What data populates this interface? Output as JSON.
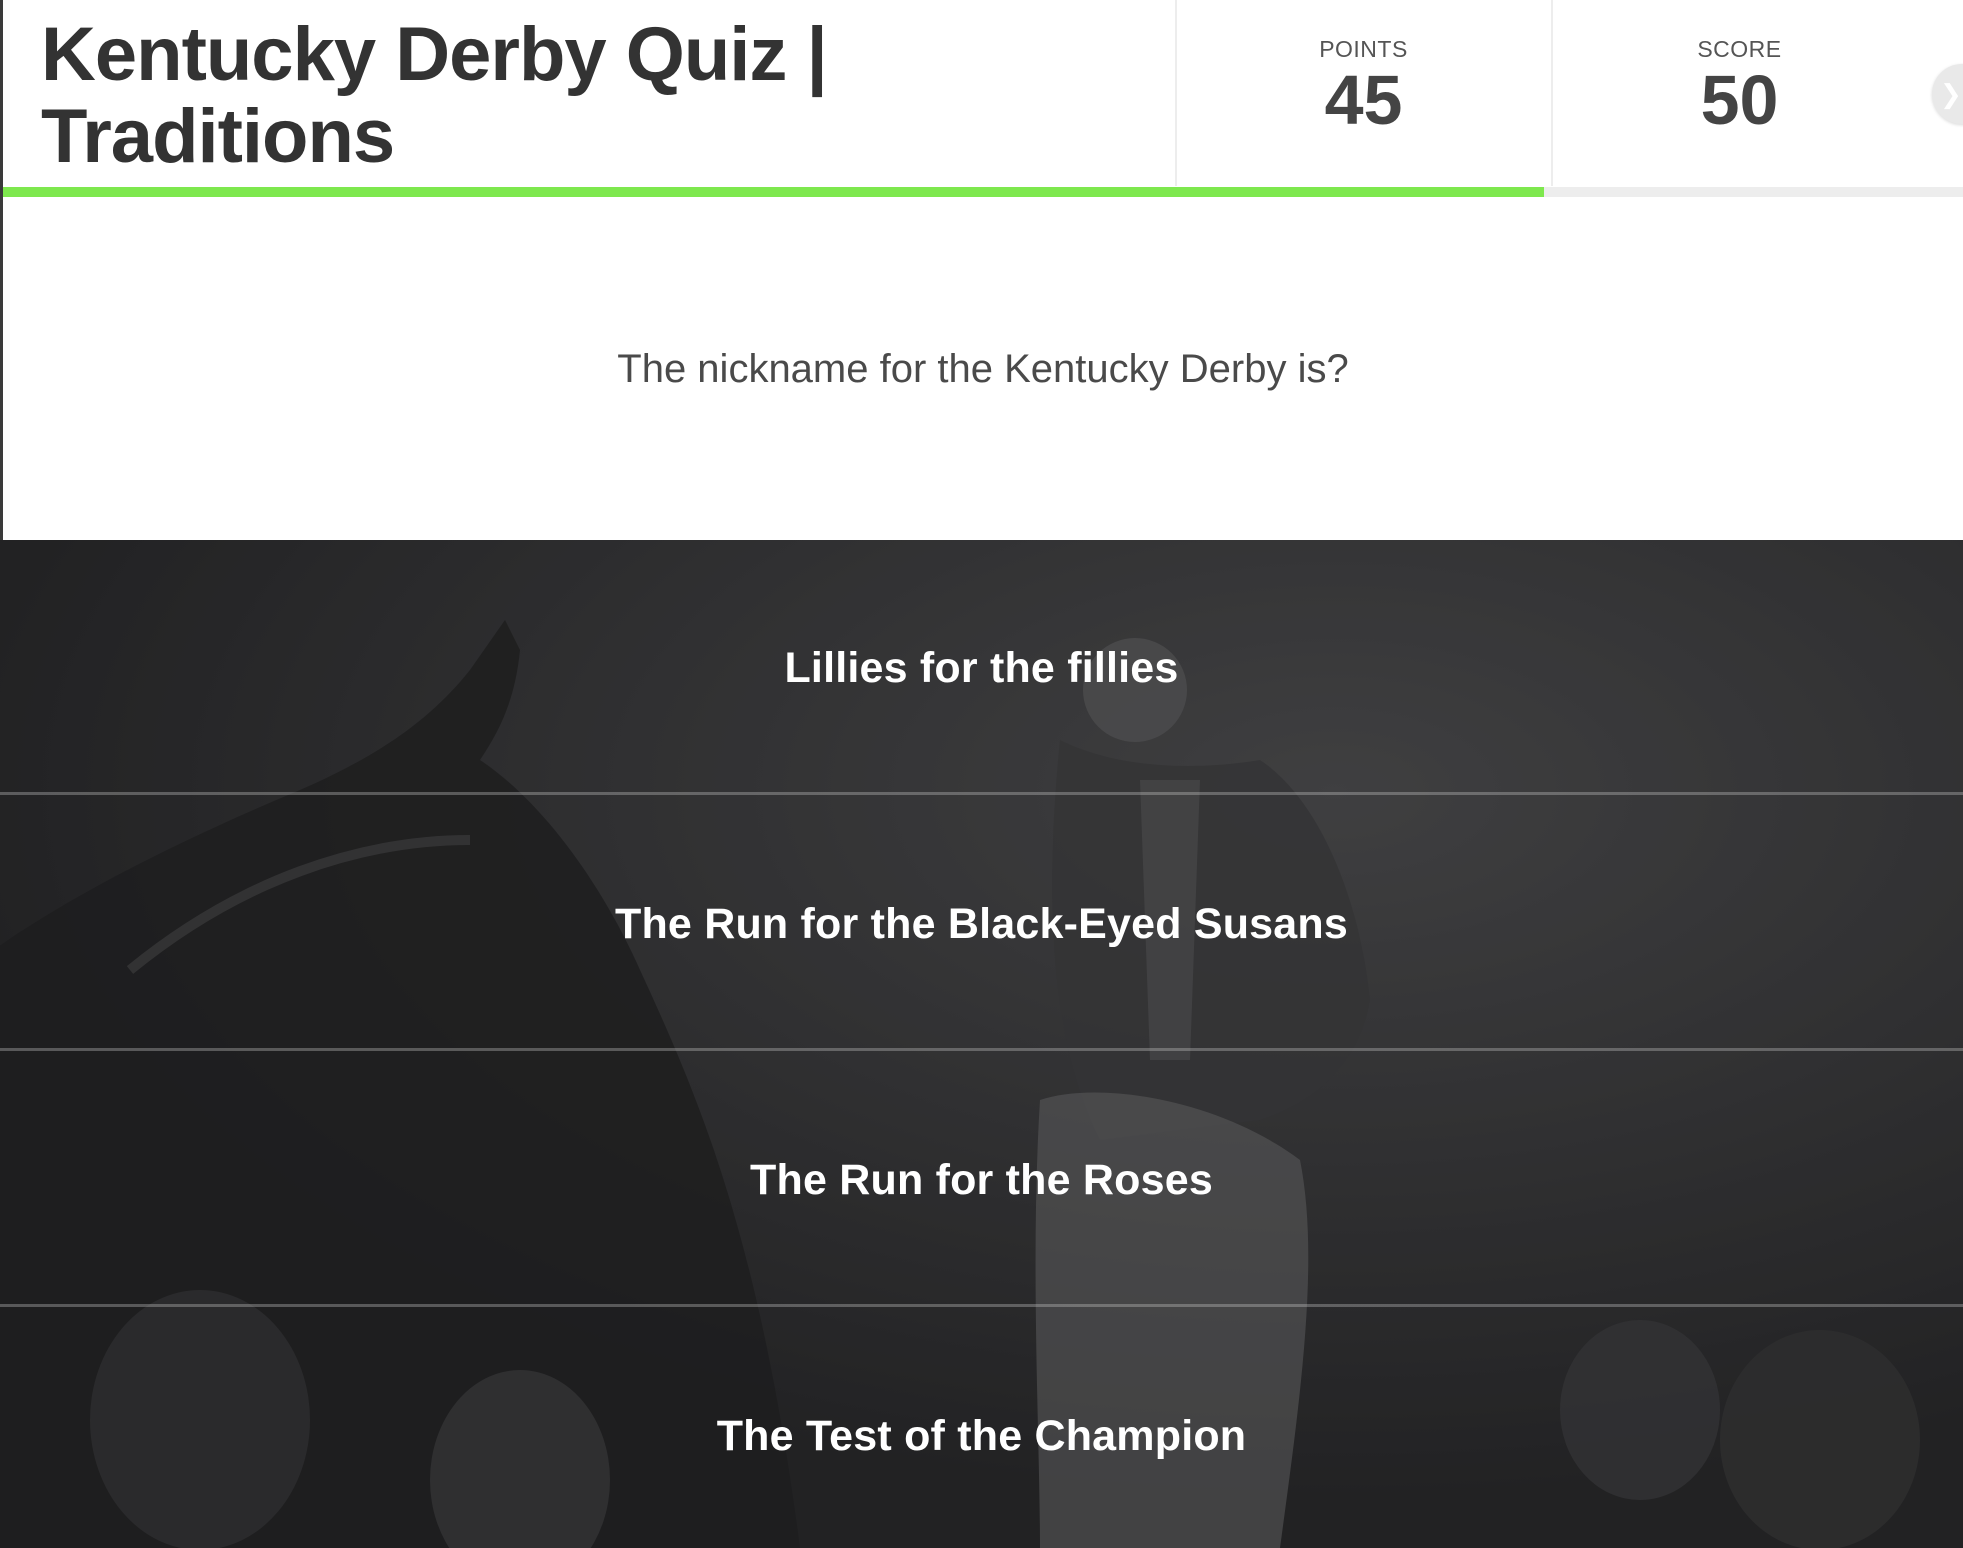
{
  "quiz": {
    "title": "Kentucky Derby Quiz | Traditions"
  },
  "stats": {
    "points_label": "POINTS",
    "points_value": "45",
    "score_label": "SCORE",
    "score_value": "50"
  },
  "progress": {
    "fraction": 0.786
  },
  "question": {
    "text": "The nickname for the Kentucky Derby is?"
  },
  "answers": [
    {
      "label": "Lillies for the fillies"
    },
    {
      "label": "The Run for the Black-Eyed Susans"
    },
    {
      "label": "The Run for the Roses"
    },
    {
      "label": "The Test of the Champion"
    }
  ],
  "icons": {
    "next": "chevron-right-icon"
  },
  "colors": {
    "progress_fill": "#7ee84e",
    "answers_background": "#2c2c2e",
    "title_text": "#333333"
  }
}
